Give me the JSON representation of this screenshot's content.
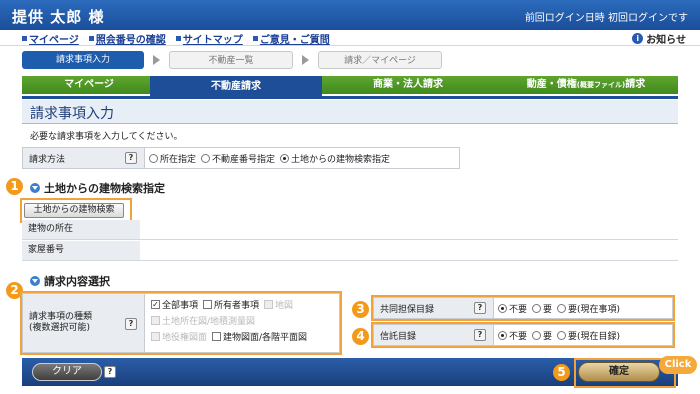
{
  "header": {
    "user_name": "提供 太郎 様",
    "last_login": "前回ログイン日時 初回ログインです"
  },
  "subnav": {
    "links": [
      "マイページ",
      "照会番号の確認",
      "サイトマップ",
      "ご意見・ご質問"
    ],
    "notice": "お知らせ"
  },
  "steps": [
    "請求事項入力",
    "不動産一覧",
    "請求／マイページ"
  ],
  "tabs": {
    "mypage": "マイページ",
    "realestate": "不動産請求",
    "corporate": "商業・法人請求",
    "movable_main": "動産・債権",
    "movable_small": "(概要ファイル)",
    "movable_tail": "請求"
  },
  "section_title": "請求事項入力",
  "instruction": "必要な請求事項を入力してください。",
  "method": {
    "label": "請求方法",
    "help": "?",
    "options": [
      "所在指定",
      "不動産番号指定",
      "土地からの建物検索指定"
    ],
    "selected_index": 2
  },
  "land_search": {
    "heading": "土地からの建物検索指定",
    "button": "土地からの建物検索",
    "rows": [
      {
        "label": "建物の所在",
        "value": ""
      },
      {
        "label": "家屋番号",
        "value": ""
      }
    ]
  },
  "content_select": {
    "heading": "請求内容選択",
    "types_label_line1": "請求事項の種類",
    "types_label_line2": "(複数選択可能)",
    "help": "?",
    "checkboxes": {
      "all": "全部事項",
      "owner": "所有者事項",
      "map": "地図",
      "land_map": "土地所在図/地積測量図",
      "easement_map": "地役権図面",
      "building_map": "建物図面/各階平面図"
    },
    "joint": {
      "label": "共同担保目録",
      "help": "?",
      "options": [
        "不要",
        "要",
        "要(現在事項)"
      ],
      "selected_index": 0
    },
    "trust": {
      "label": "信託目録",
      "help": "?",
      "options": [
        "不要",
        "要",
        "要(現在目録)"
      ],
      "selected_index": 0
    }
  },
  "badges": [
    "1",
    "2",
    "3",
    "4",
    "5"
  ],
  "footer": {
    "clear": "クリア",
    "help": "?",
    "confirm": "確定",
    "click": "Click"
  },
  "colors": {
    "header": "#1f5aa8",
    "tab_green": "#4a9a26",
    "tab_active": "#1e4e98",
    "callout": "#f39a1a"
  }
}
